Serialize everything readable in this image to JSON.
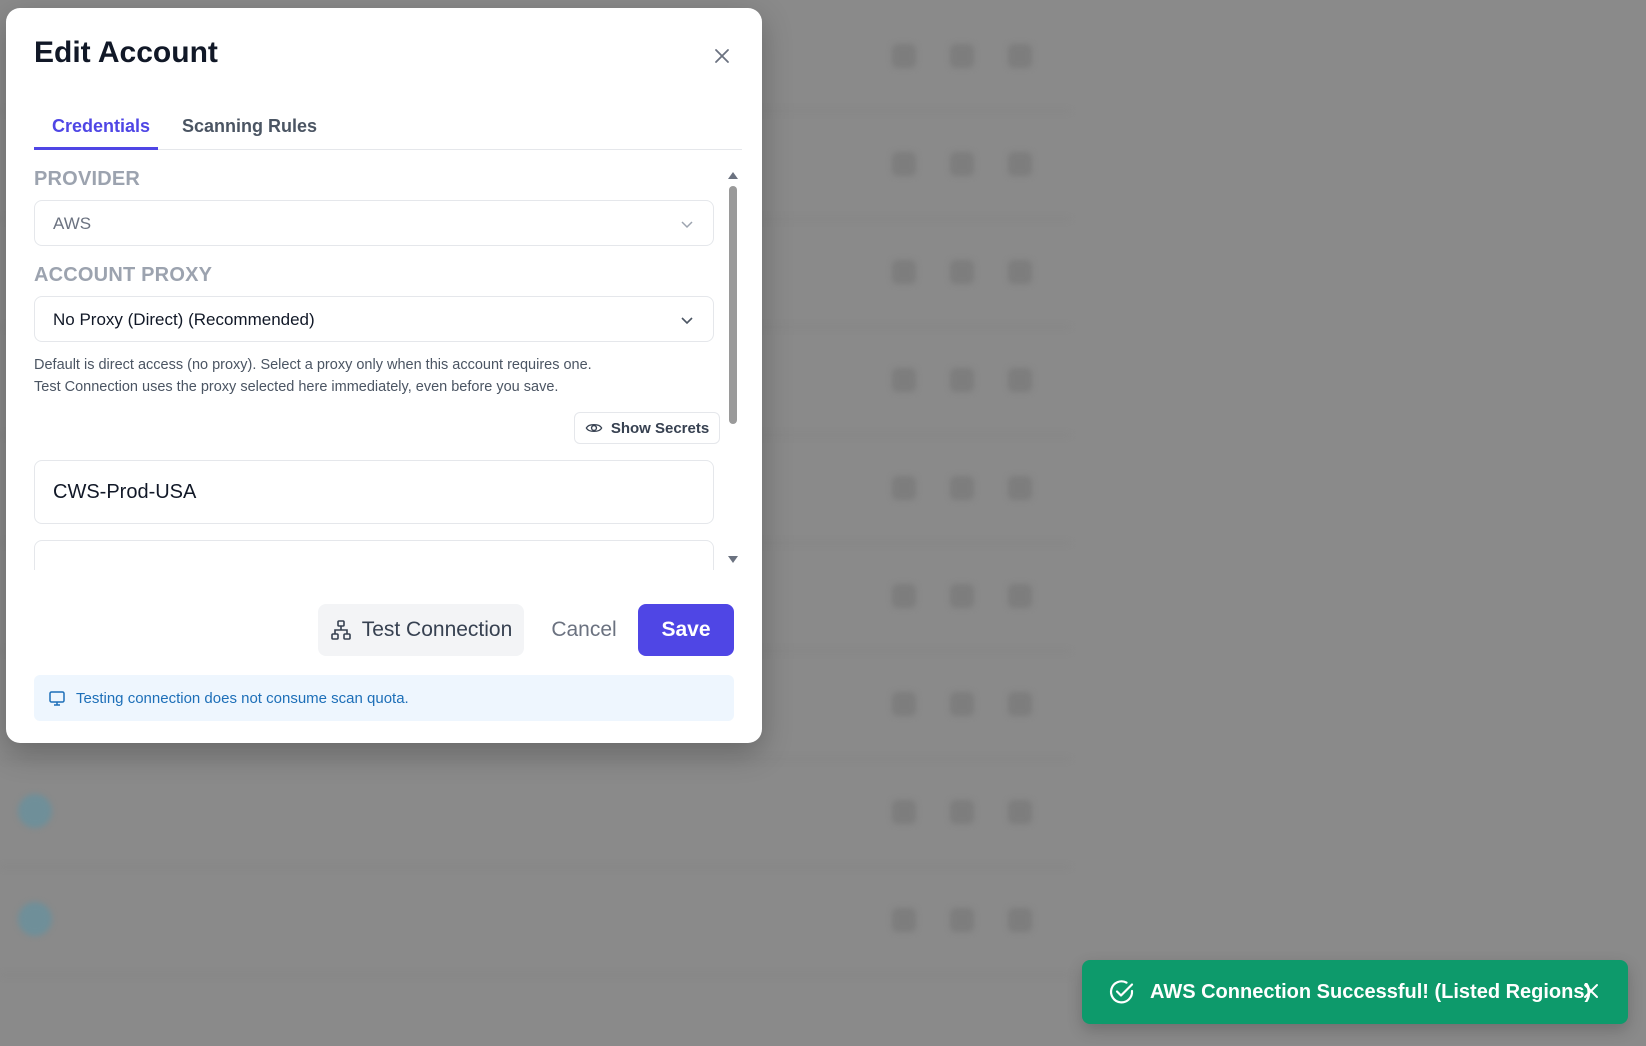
{
  "background": {
    "rows": [
      {
        "name": "",
        "sub": ""
      },
      {
        "name": "",
        "sub": ""
      },
      {
        "name": "",
        "sub": ""
      },
      {
        "name": "",
        "sub": ""
      },
      {
        "name": "",
        "sub": ""
      },
      {
        "name": "",
        "sub": ""
      },
      {
        "name": "",
        "sub": ""
      },
      {
        "name": "",
        "sub": ""
      },
      {
        "name": "",
        "sub": ""
      }
    ]
  },
  "modal": {
    "title": "Edit Account",
    "tabs": [
      {
        "label": "Credentials",
        "active": true
      },
      {
        "label": "Scanning Rules",
        "active": false
      }
    ],
    "provider": {
      "label": "PROVIDER",
      "value": "AWS"
    },
    "proxy": {
      "label": "ACCOUNT PROXY",
      "value": "No Proxy (Direct) (Recommended)",
      "help_line1": "Default is direct access (no proxy). Select a proxy only when this account requires one.",
      "help_line2": "Test Connection uses the proxy selected here immediately, even before you save."
    },
    "show_secrets_label": "Show Secrets",
    "account_name_value": "CWS-Prod-USA",
    "second_field_value": "",
    "buttons": {
      "test_connection": "Test Connection",
      "cancel": "Cancel",
      "save": "Save"
    },
    "info_text": "Testing connection does not consume scan quota."
  },
  "toast": {
    "message": "AWS Connection Successful! (Listed Regions)",
    "color": "#0d9a6b"
  },
  "colors": {
    "accent": "#4f46e5",
    "info_text": "#1d6fb8",
    "info_bg": "#eef6fe"
  },
  "icons": [
    "close-icon",
    "chevron-down-icon",
    "eye-icon",
    "network-icon",
    "monitor-icon",
    "check-circle-icon"
  ]
}
